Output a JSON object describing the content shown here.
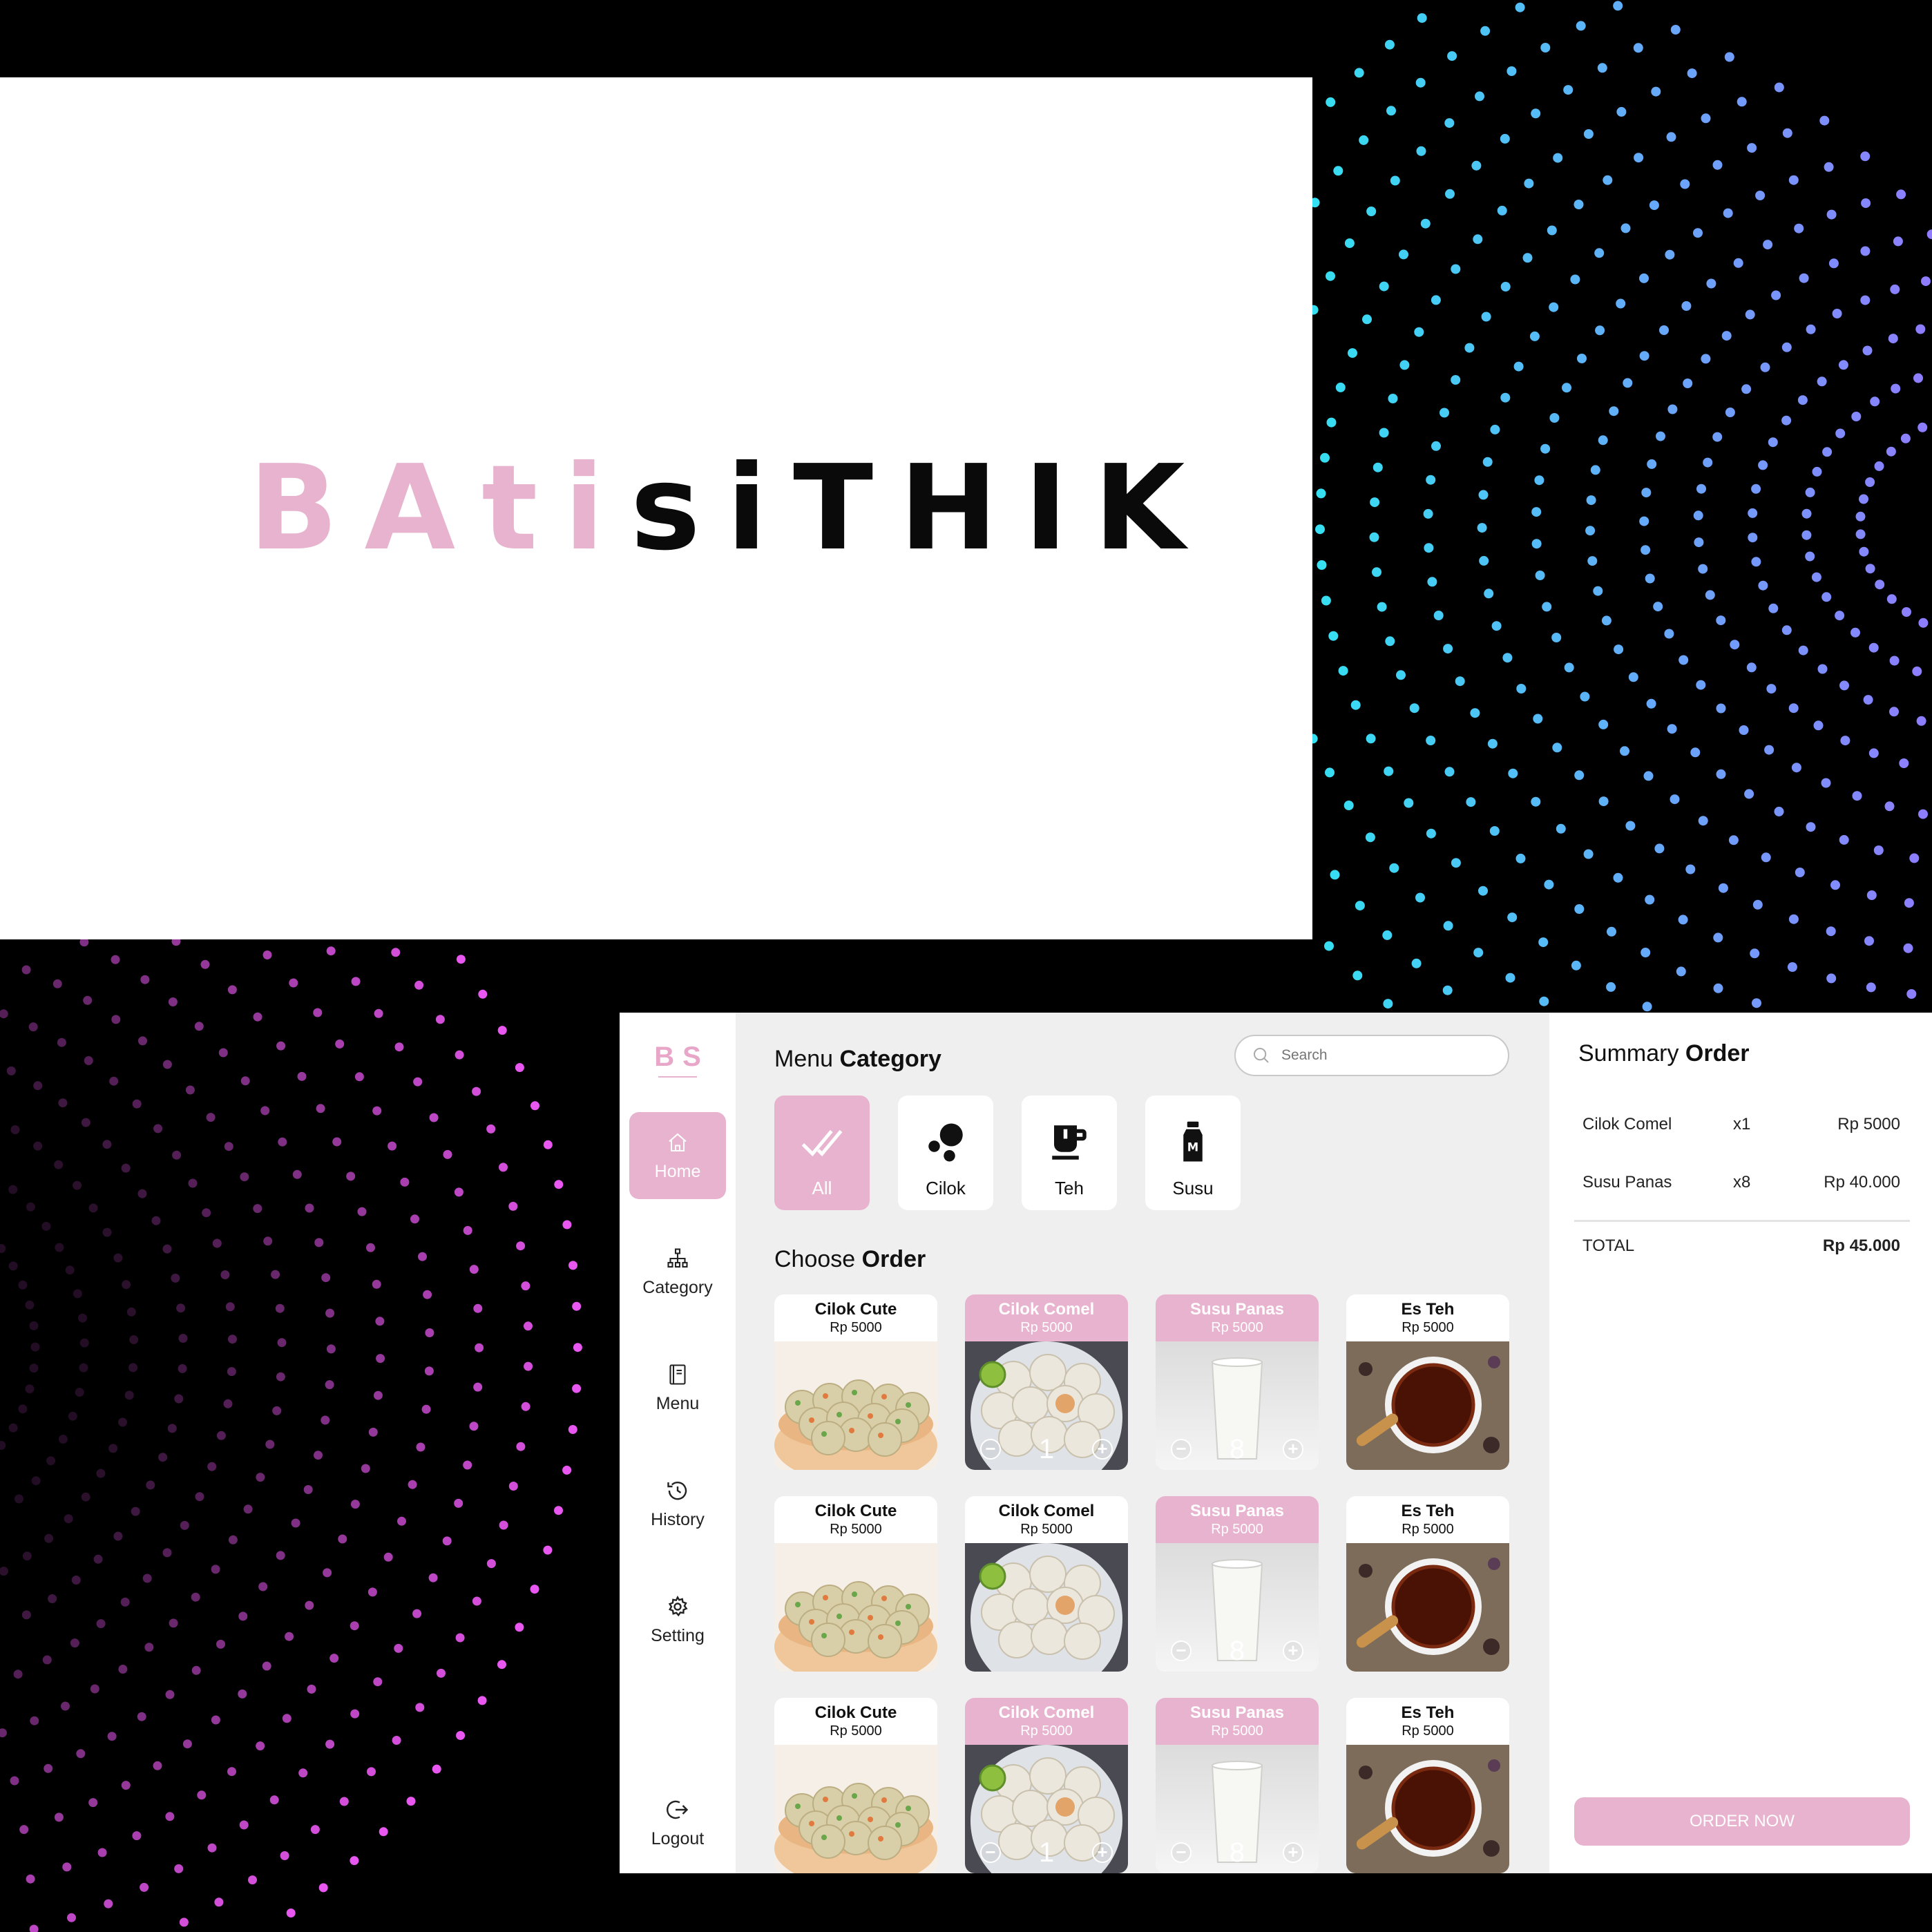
{
  "colors": {
    "accent": "#e8b3cf",
    "panel": "#efefef",
    "dots_cyan": "#35e0f2",
    "dots_violet": "#8f7cff",
    "dots_magenta": "#e857f0"
  },
  "logo": {
    "part1": "BAti",
    "part2": "siTHIK"
  },
  "app": {
    "brand": "BS",
    "nav": [
      {
        "label": "Home",
        "icon": "home-icon",
        "active": true
      },
      {
        "label": "Category",
        "icon": "hierarchy-icon",
        "active": false
      },
      {
        "label": "Menu",
        "icon": "book-icon",
        "active": false
      },
      {
        "label": "History",
        "icon": "history-icon",
        "active": false
      },
      {
        "label": "Setting",
        "icon": "gear-icon",
        "active": false
      }
    ],
    "logout": {
      "label": "Logout",
      "icon": "logout-icon"
    },
    "menu_category": {
      "light": "Menu",
      "bold": "Category"
    },
    "search": {
      "placeholder": "Search"
    },
    "categories": [
      {
        "label": "All",
        "icon": "double-check-icon",
        "active": true
      },
      {
        "label": "Cilok",
        "icon": "balls-icon",
        "active": false
      },
      {
        "label": "Teh",
        "icon": "tea-cup-icon",
        "active": false
      },
      {
        "label": "Susu",
        "icon": "milk-bottle-icon",
        "active": false
      }
    ],
    "choose_order": {
      "light": "Choose",
      "bold": "Order"
    },
    "products": [
      [
        {
          "name": "Cilok Cute",
          "price": "Rp 5000",
          "image": "cilok-cute",
          "selected": false,
          "qty": ""
        },
        {
          "name": "Cilok Comel",
          "price": "Rp 5000",
          "image": "cilok-comel",
          "selected": true,
          "qty": "1"
        },
        {
          "name": "Susu Panas",
          "price": "Rp 5000",
          "image": "susu-panas",
          "selected": true,
          "qty": "8"
        },
        {
          "name": "Es Teh",
          "price": "Rp 5000",
          "image": "es-teh",
          "selected": false,
          "qty": ""
        }
      ],
      [
        {
          "name": "Cilok Cute",
          "price": "Rp 5000",
          "image": "cilok-cute",
          "selected": false,
          "qty": ""
        },
        {
          "name": "Cilok Comel",
          "price": "Rp 5000",
          "image": "cilok-comel",
          "selected": false,
          "qty": ""
        },
        {
          "name": "Susu Panas",
          "price": "Rp 5000",
          "image": "susu-panas",
          "selected": true,
          "qty": "8"
        },
        {
          "name": "Es Teh",
          "price": "Rp 5000",
          "image": "es-teh",
          "selected": false,
          "qty": ""
        }
      ],
      [
        {
          "name": "Cilok Cute",
          "price": "Rp 5000",
          "image": "cilok-cute",
          "selected": false,
          "qty": ""
        },
        {
          "name": "Cilok Comel",
          "price": "Rp 5000",
          "image": "cilok-comel",
          "selected": true,
          "qty": "1"
        },
        {
          "name": "Susu Panas",
          "price": "Rp 5000",
          "image": "susu-panas",
          "selected": true,
          "qty": "8"
        },
        {
          "name": "Es Teh",
          "price": "Rp 5000",
          "image": "es-teh",
          "selected": false,
          "qty": ""
        }
      ]
    ],
    "summary": {
      "light": "Summary",
      "bold": "Order",
      "items": [
        {
          "name": "Cilok Comel",
          "qty": "x1",
          "price": "Rp 5000"
        },
        {
          "name": "Susu Panas",
          "qty": "x8",
          "price": "Rp 40.000"
        }
      ],
      "total_label": "TOTAL",
      "total_value": "Rp 45.000",
      "order_button": "ORDER NOW"
    }
  }
}
